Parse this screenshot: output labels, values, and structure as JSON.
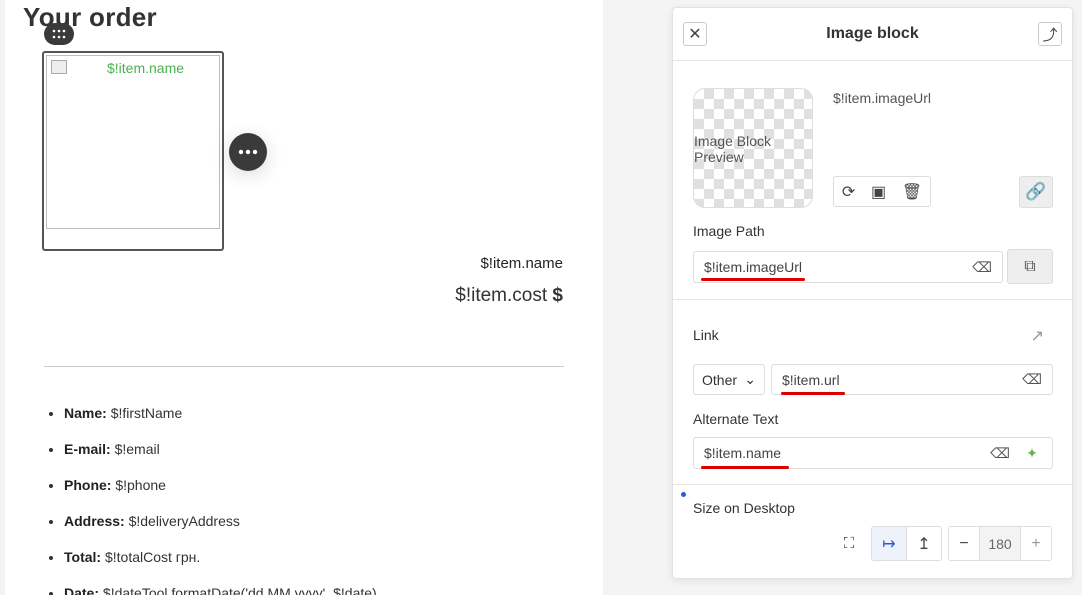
{
  "canvas": {
    "title": "Your order",
    "image_alt": "$!item.name",
    "item_name": "$!item.name",
    "item_cost": "$!item.cost",
    "currency": "$",
    "info": [
      {
        "label": "Name:",
        "value": "$!firstName"
      },
      {
        "label": "E-mail:",
        "value": "$!email"
      },
      {
        "label": "Phone:",
        "value": "$!phone"
      },
      {
        "label": "Address:",
        "value": "$!deliveryAddress"
      },
      {
        "label": "Total:",
        "value": "$!totalCost грн."
      },
      {
        "label": "Date:",
        "value": "$!dateTool.formatDate('dd.MM.yyyy', $!date)"
      }
    ]
  },
  "panel": {
    "title": "Image block",
    "preview_alt": "Image Block Preview",
    "image_url": "$!item.imageUrl",
    "image_path_label": "Image Path",
    "image_path_value": "$!item.imageUrl",
    "link_label": "Link",
    "link_type": "Other",
    "link_value": "$!item.url",
    "alt_label": "Alternate Text",
    "alt_value": "$!item.name",
    "size_label": "Size on Desktop",
    "size_value": "180"
  },
  "colors": {
    "accent_blue": "#2a5bd7",
    "alt_green": "#4caf50",
    "underline_red": "#d00000"
  }
}
